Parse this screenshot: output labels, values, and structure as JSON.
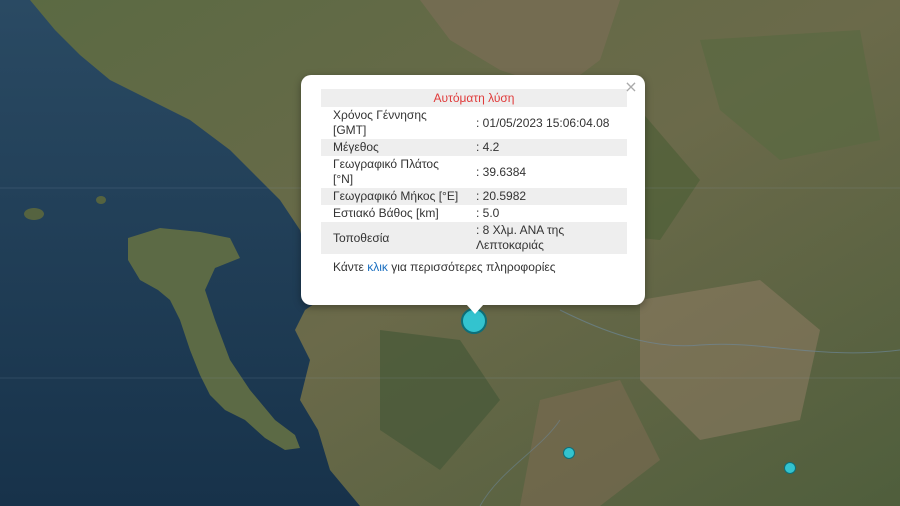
{
  "popup": {
    "title": "Αυτόματη λύση",
    "close_symbol": "×",
    "rows": [
      {
        "label": "Χρόνος Γέννησης [GMT]",
        "value": ": 01/05/2023 15:06:04.08"
      },
      {
        "label": "Μέγεθος",
        "value": ": 4.2"
      },
      {
        "label": "Γεωγραφικό Πλάτος [°N]",
        "value": ": 39.6384"
      },
      {
        "label": "Γεωγραφικό Μήκος [°E]",
        "value": ": 20.5982"
      },
      {
        "label": "Εστιακό Βάθος [km]",
        "value": ": 5.0"
      },
      {
        "label": "Τοποθεσία",
        "value": ": 8 Χλμ. ΑΝΑ της Λεπτοκαριάς"
      }
    ],
    "footer_prefix": "Κάντε ",
    "footer_link": "κλικ",
    "footer_suffix": " για περισσότερες πληροφορίες"
  },
  "map": {
    "style": "satellite",
    "marker_color": "#33c3cf",
    "markers": [
      "main-epicenter",
      "event",
      "event"
    ]
  }
}
